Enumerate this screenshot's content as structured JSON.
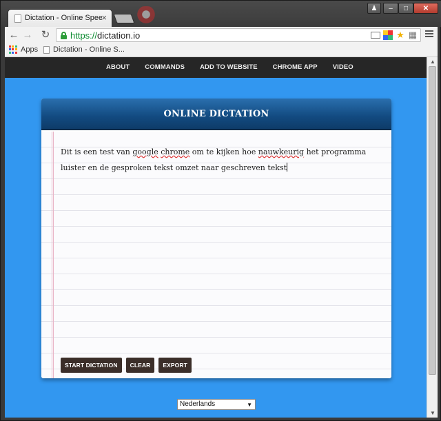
{
  "browser": {
    "tab_title": "Dictation - Online Speech",
    "tab_close": "×",
    "url_scheme": "https://",
    "url_host": "dictation.io",
    "bookmarks": {
      "apps_label": "Apps",
      "page_label": "Dictation - Online S..."
    }
  },
  "nav": {
    "items": [
      "ABOUT",
      "COMMANDS",
      "ADD TO WEBSITE",
      "CHROME APP",
      "VIDEO"
    ]
  },
  "panel": {
    "title": "ONLINE DICTATION",
    "text_parts": [
      "Dit is een test van ",
      "google",
      " ",
      "chrome",
      " om te kijken hoe ",
      "nauwkeurig",
      " het programma luister en de gesproken tekst omzet naar geschreven tekst"
    ],
    "buttons": {
      "start": "START DICTATION",
      "clear": "CLEAR",
      "export": "EXPORT"
    }
  },
  "language": {
    "selected": "Nederlands"
  },
  "colors": {
    "page_background": "#3297f0",
    "header_blue": "#124a80",
    "button_brown": "#3b2e29",
    "navbar_dark": "#262626"
  }
}
